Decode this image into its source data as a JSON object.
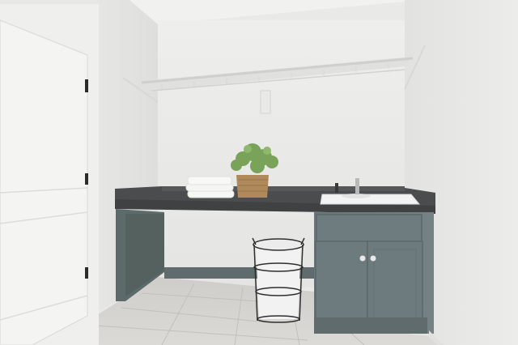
{
  "scene": {
    "description_free": true,
    "colors": {
      "wall": "#ebebe9",
      "wall_shadow": "#d9d9d7",
      "ceiling": "#f1f1ef",
      "door": "#f4f4f2",
      "door_frame": "#efefed",
      "countertop": "#4a4c4e",
      "cabinet": "#6d7b7d",
      "cabinet_dark": "#5b6769",
      "baseboard": "#5f6b6c",
      "floor": "#d6d4d0",
      "floor_grout": "#c3c1bd",
      "shelf_rod": "#dcdcdc",
      "sink": "#f3f3f3",
      "towel": "#f7f7f5",
      "basket": "#b08a5b",
      "plant": "#7aa35a",
      "hamper_frame": "#2e2e2e",
      "hamper_liner": "#f2f2f2"
    },
    "icons": [
      "door-icon",
      "door-hinge-icon",
      "wire-shelf-icon",
      "countertop-icon",
      "sink-icon",
      "faucet-icon",
      "cabinet-icon",
      "cabinet-knob-icon",
      "towel-stack-icon",
      "plant-basket-icon",
      "laundry-hamper-icon",
      "floor-tile-icon"
    ]
  }
}
